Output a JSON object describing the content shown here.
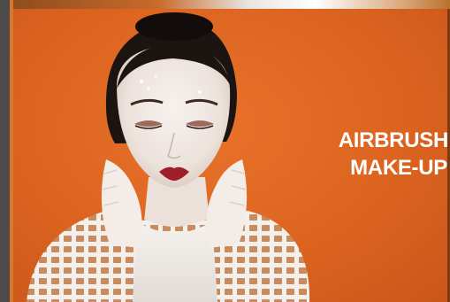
{
  "headline": {
    "line1": "AIRBRUSH",
    "line2": "MAKE-UP"
  },
  "colors": {
    "background_orange": "#dc6420",
    "sidebar_gray": "#4d4b49",
    "text": "#ffffff"
  },
  "image": {
    "subject": "woman-with-white-face-makeup-portrait"
  }
}
